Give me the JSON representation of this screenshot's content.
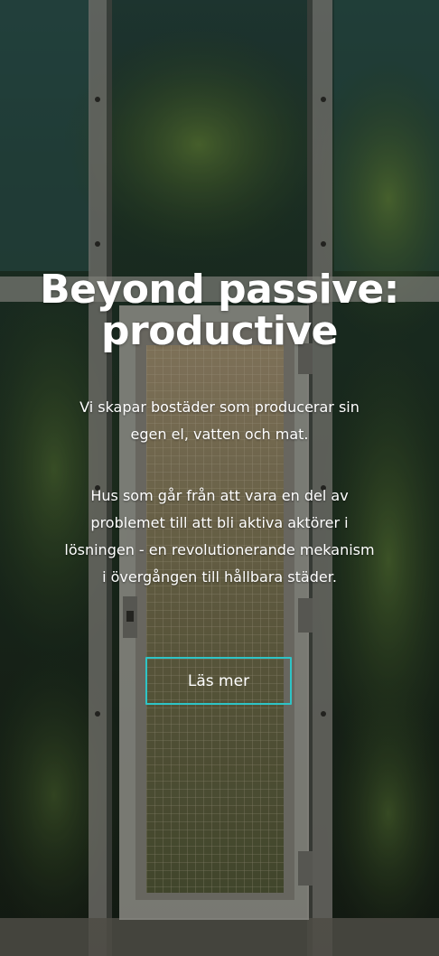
{
  "hero": {
    "headline_line1": "Beyond passive:",
    "headline_line2": "productive",
    "intro": "Vi skapar bostäder som producerar sin egen el, vatten och mat.",
    "body": "Hus som går från att vara en del av problemet till att bli aktiva aktörer i lösningen - en revolutionerande mekanism i övergången till hållbara städer.",
    "cta_label": "Läs mer"
  },
  "colors": {
    "accent": "#2ec4c6",
    "text": "#ffffff"
  }
}
